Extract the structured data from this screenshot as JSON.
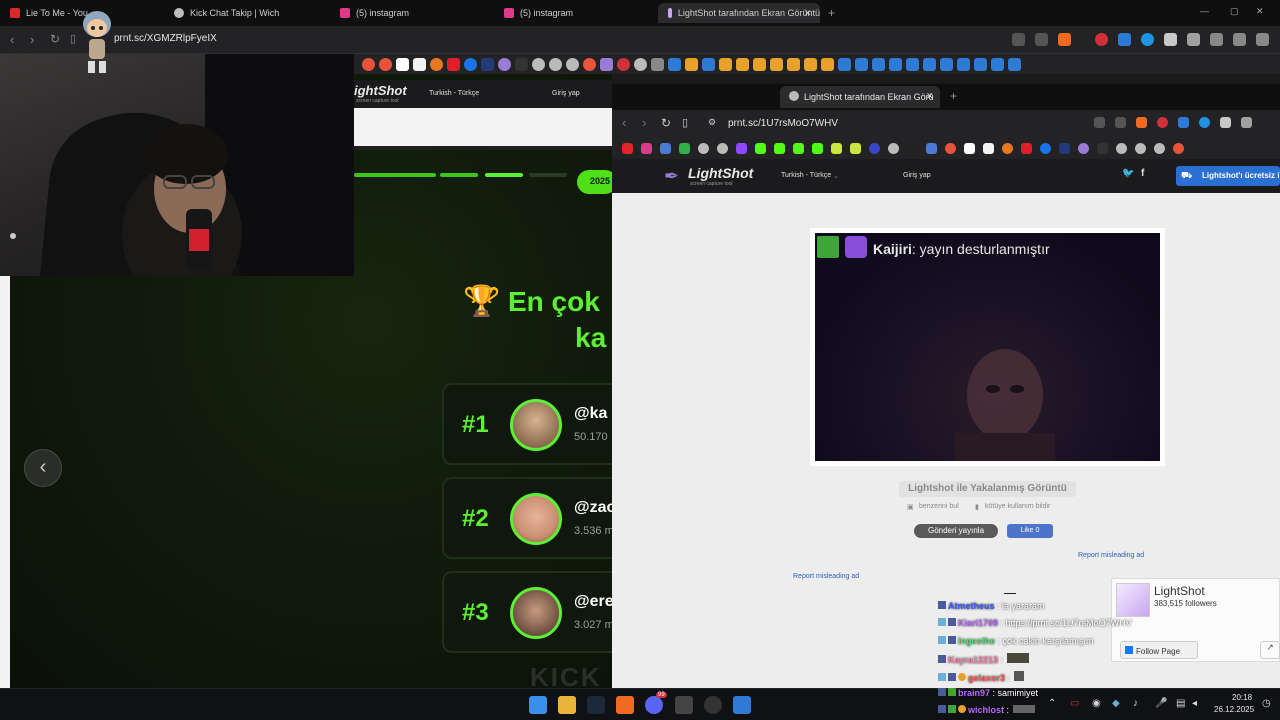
{
  "back_window": {
    "tabs": [
      {
        "label": "Lie To Me - You",
        "icon_color": "#e02727"
      },
      {
        "label": "Kick Chat Takip | Wich",
        "icon_color": "#bbbbbb"
      },
      {
        "label": "(5) instagram",
        "icon_color": "#dd3b8a"
      },
      {
        "label": "(5) instagram",
        "icon_color": "#dd3b8a"
      },
      {
        "label": "LightShot tarafından Ekran Görüntü",
        "icon_color": "#c9a8ef"
      }
    ],
    "new_tab": "+",
    "tab_close": "✕",
    "url": "prnt.sc/XGMZRlpFyeIX",
    "header": {
      "language": "Turkish - Türkçe",
      "login": "Giriş yap",
      "logo": "ightShot",
      "logo_sub": "screen capture tool"
    },
    "page": {
      "year_badge": "2025",
      "title_line1": "En çok",
      "title_line2": "ka",
      "prev_arrow": "‹",
      "watermark": "KICK",
      "rankings": [
        {
          "rank": "#1",
          "name": "@ka",
          "count": "50.170",
          "avatar_color": "#8a6b4f"
        },
        {
          "rank": "#2",
          "name": "@zac",
          "count": "3.536 m",
          "avatar_color": "#c98f72"
        },
        {
          "rank": "#3",
          "name": "@ere",
          "count": "3.027 m",
          "avatar_color": "#7a5a4a"
        }
      ]
    }
  },
  "front_window": {
    "tab_label": "LightShot tarafından Ekran Görü",
    "tab_close": "✕",
    "new_tab": "+",
    "url": "prnt.sc/1U7rsMoO7WHV",
    "header": {
      "logo": "LightShot",
      "logo_sub": "screen capture tool",
      "language": "Turkish - Türkçe",
      "login": "Giriş yap",
      "install": "Lightshot'ı ücretsiz i"
    },
    "screenshot": {
      "chat_name": "Kaijiri",
      "chat_text": ": yayın desturlanmıştır"
    },
    "caption": "Lightshot ile Yakalanmış Görüntü",
    "find_similar": "benzerini bul",
    "report_abuse": "kötüye kullanım bildir",
    "tweet": "Gönderi yayınla",
    "like": "Like 0",
    "report_ad_1": "Report misleading ad",
    "report_ad_2": "Report misleading ad",
    "fb": {
      "title": "LightShot",
      "followers": "383,515 followers",
      "follow": "Follow Page",
      "share": "↗"
    }
  },
  "chat_overlay": [
    {
      "user": "Atmetheus",
      "msg": " : la yararam",
      "color": "#3b5cff"
    },
    {
      "user": "Kiari1709",
      "msg": " : https://prnt.sc/1U7rsMoO7WHV",
      "color": "#b86cff"
    },
    {
      "user": "Ingesthe",
      "msg": " : çok cakin karşılamışım",
      "color": "#53e07a"
    },
    {
      "user": "Kayra12213",
      "msg": " :",
      "color": "#ff7ea8"
    },
    {
      "user": "gelaxor3",
      "msg": " :",
      "color": "#ff5a5a"
    },
    {
      "user": "brain97",
      "msg": " : samimiyet",
      "color": "#b86cff"
    },
    {
      "user": "wichlost",
      "msg": " :",
      "color": "#b86cff"
    }
  ],
  "taskbar": {
    "time": "20:18",
    "date": "26.12.2025",
    "notification_count": "99"
  },
  "colors": {
    "accent_green": "#5cf035",
    "lightshot_blue": "#2b6fd3"
  }
}
